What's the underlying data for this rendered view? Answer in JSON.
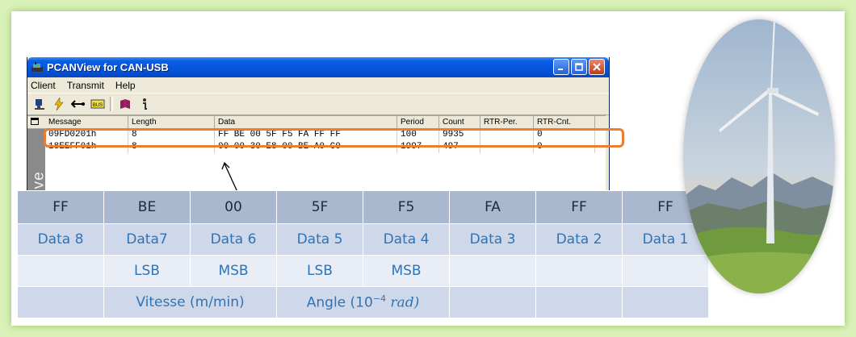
{
  "window": {
    "title": "PCANView for CAN-USB",
    "menu": [
      "Client",
      "Transmit",
      "Help"
    ],
    "side_tab_label": "ceive",
    "columns": [
      "Message",
      "Length",
      "Data",
      "Period",
      "Count",
      "RTR-Per.",
      "RTR-Cnt."
    ],
    "rows": [
      {
        "message": "09FD0201h",
        "length": "8",
        "data": "FF BE 00 5F F5 FA FF FF",
        "period": "100",
        "count": "9935",
        "rtr_per": "",
        "rtr_cnt": "0"
      },
      {
        "message": "18EEFF01h",
        "length": "8",
        "data": "00 00 30 E8 00 BE A0 C0",
        "period": "1997",
        "count": "497",
        "rtr_per": "",
        "rtr_cnt": "0"
      }
    ]
  },
  "bytes_table": {
    "bytes": [
      "FF",
      "BE",
      "00",
      "5F",
      "F5",
      "FA",
      "FF",
      "FF"
    ],
    "labels": [
      "Data 8",
      "Data7",
      "Data 6",
      "Data 5",
      "Data 4",
      "Data 3",
      "Data 2",
      "Data 1"
    ],
    "order": [
      "",
      "LSB",
      "MSB",
      "LSB",
      "MSB",
      "",
      "",
      ""
    ],
    "speed": "Vitesse (m/min)",
    "angle_prefix": "Angle (10",
    "angle_exp": "−4",
    "angle_unit": " rad)"
  },
  "colors": {
    "highlight": "#ed7d31",
    "header_row": "#a9b7cf",
    "text_blue": "#2e74b5",
    "slide_bg": "#d9f2b8"
  }
}
